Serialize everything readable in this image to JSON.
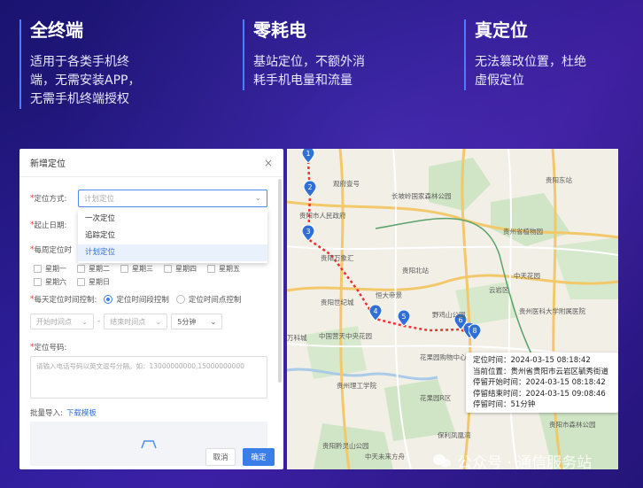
{
  "features": [
    {
      "title": "全终端",
      "desc_lines": [
        "适用于各类手机终",
        "端，无需安装APP，",
        "无需手机终端授权"
      ]
    },
    {
      "title": "零耗电",
      "desc_lines": [
        "基站定位，不额外消",
        "耗手机电量和流量"
      ]
    },
    {
      "title": "真定位",
      "desc_lines": [
        "无法篡改位置，杜绝",
        "虚假定位"
      ]
    }
  ],
  "dialog": {
    "title": "新增定位",
    "close": "×",
    "method_label": "定位方式:",
    "method_placeholder": "计划定位",
    "dropdown_options": [
      "一次定位",
      "追踪定位",
      "计划定位"
    ],
    "date_label": "起止日期:",
    "weekly_label": "每周定位时",
    "weekdays": [
      "星期一",
      "星期二",
      "星期三",
      "星期四",
      "星期五",
      "星期六",
      "星期日"
    ],
    "daily_label": "每天定位时间控制:",
    "radio_period": "定位时间段控制",
    "radio_point": "定位时间点控制",
    "start_time": "开始时间点",
    "end_time": "结束时间点",
    "interval": "5分钟",
    "number_label": "定位号码:",
    "number_placeholder": "请输入电话号码以英文逗号分隔。如：13000000000,15000000000",
    "batch_label": "批量导入:",
    "template_link": "下载模板",
    "cancel": "取消",
    "confirm": "确定"
  },
  "map": {
    "popup": {
      "time": "定位时间：2024-03-15 08:18:42",
      "location": "当前位置：贵州省贵阳市云岩区毓秀街道",
      "stay_start": "停留开始时间：2024-03-15 08:18:42",
      "stay_end": "停留结束时间：2024-03-15 09:08:46",
      "stay_duration": "停留时间：51分钟"
    },
    "markers": [
      "1",
      "2",
      "3",
      "4",
      "5",
      "6",
      "7",
      "8"
    ],
    "labels": [
      "观府壹号",
      "贵阳市人民政府",
      "长坡岭国家森林公园",
      "贵阳东站",
      "贵州省植物园",
      "贵阳万象汇",
      "贵阳北站",
      "中天花园",
      "贵阳世纪城",
      "恒大帝景",
      "野鸡山公园",
      "贵州医科大学附属医院",
      "万科城",
      "中国营天中央花园",
      "花果园购物中心",
      "贵州理工学院",
      "花果园R区",
      "保利凤凰湾",
      "贵阳黔灵山公园",
      "中天未来方舟",
      "贵阳市森林公园",
      "云岩区"
    ],
    "road_signs": [
      "G210",
      "G210",
      "G210",
      "G75",
      "S10"
    ]
  },
  "watermark": "公众号 · 通信服务站"
}
